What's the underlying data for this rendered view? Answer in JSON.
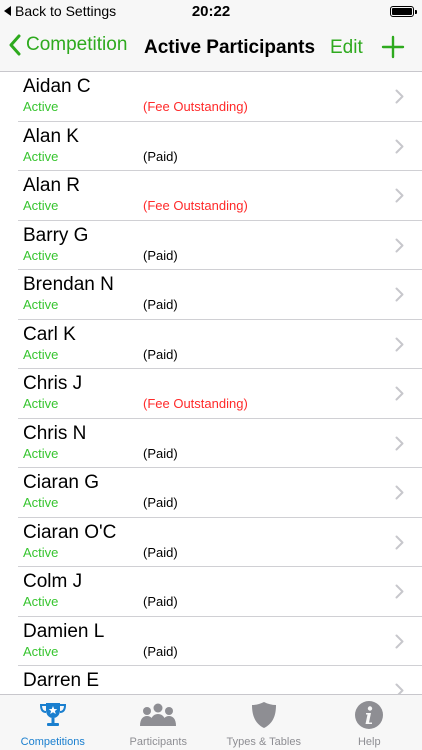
{
  "status_bar": {
    "back_label": "Back to Settings",
    "time": "20:22"
  },
  "nav": {
    "back_label": "Competition",
    "title": "Active Participants",
    "edit_label": "Edit",
    "add_icon": "plus-icon"
  },
  "participants": [
    {
      "name": "Aidan C",
      "status": "Active",
      "fee": "(Fee Outstanding)",
      "fee_state": "outstanding"
    },
    {
      "name": "Alan K",
      "status": "Active",
      "fee": "(Paid)",
      "fee_state": "paid"
    },
    {
      "name": "Alan R",
      "status": "Active",
      "fee": "(Fee Outstanding)",
      "fee_state": "outstanding"
    },
    {
      "name": "Barry G",
      "status": "Active",
      "fee": "(Paid)",
      "fee_state": "paid"
    },
    {
      "name": "Brendan N",
      "status": "Active",
      "fee": "(Paid)",
      "fee_state": "paid"
    },
    {
      "name": "Carl K",
      "status": "Active",
      "fee": "(Paid)",
      "fee_state": "paid"
    },
    {
      "name": "Chris J",
      "status": "Active",
      "fee": "(Fee Outstanding)",
      "fee_state": "outstanding"
    },
    {
      "name": "Chris N",
      "status": "Active",
      "fee": "(Paid)",
      "fee_state": "paid"
    },
    {
      "name": "Ciaran G",
      "status": "Active",
      "fee": "(Paid)",
      "fee_state": "paid"
    },
    {
      "name": "Ciaran O'C",
      "status": "Active",
      "fee": "(Paid)",
      "fee_state": "paid"
    },
    {
      "name": "Colm J",
      "status": "Active",
      "fee": "(Paid)",
      "fee_state": "paid"
    },
    {
      "name": "Damien L",
      "status": "Active",
      "fee": "(Paid)",
      "fee_state": "paid"
    },
    {
      "name": "Darren E",
      "status": "",
      "fee": "",
      "fee_state": "paid"
    }
  ],
  "tabs": [
    {
      "label": "Competitions",
      "icon": "trophy-icon",
      "active": true
    },
    {
      "label": "Participants",
      "icon": "people-icon",
      "active": false
    },
    {
      "label": "Types & Tables",
      "icon": "shield-icon",
      "active": false
    },
    {
      "label": "Help",
      "icon": "info-icon",
      "active": false
    }
  ],
  "colors": {
    "accent_green": "#2eaa1e",
    "status_green": "#37c52f",
    "outstanding_red": "#ff2a2a",
    "active_tab_blue": "#1a7fcf",
    "inactive_tab_gray": "#8e8e93"
  }
}
